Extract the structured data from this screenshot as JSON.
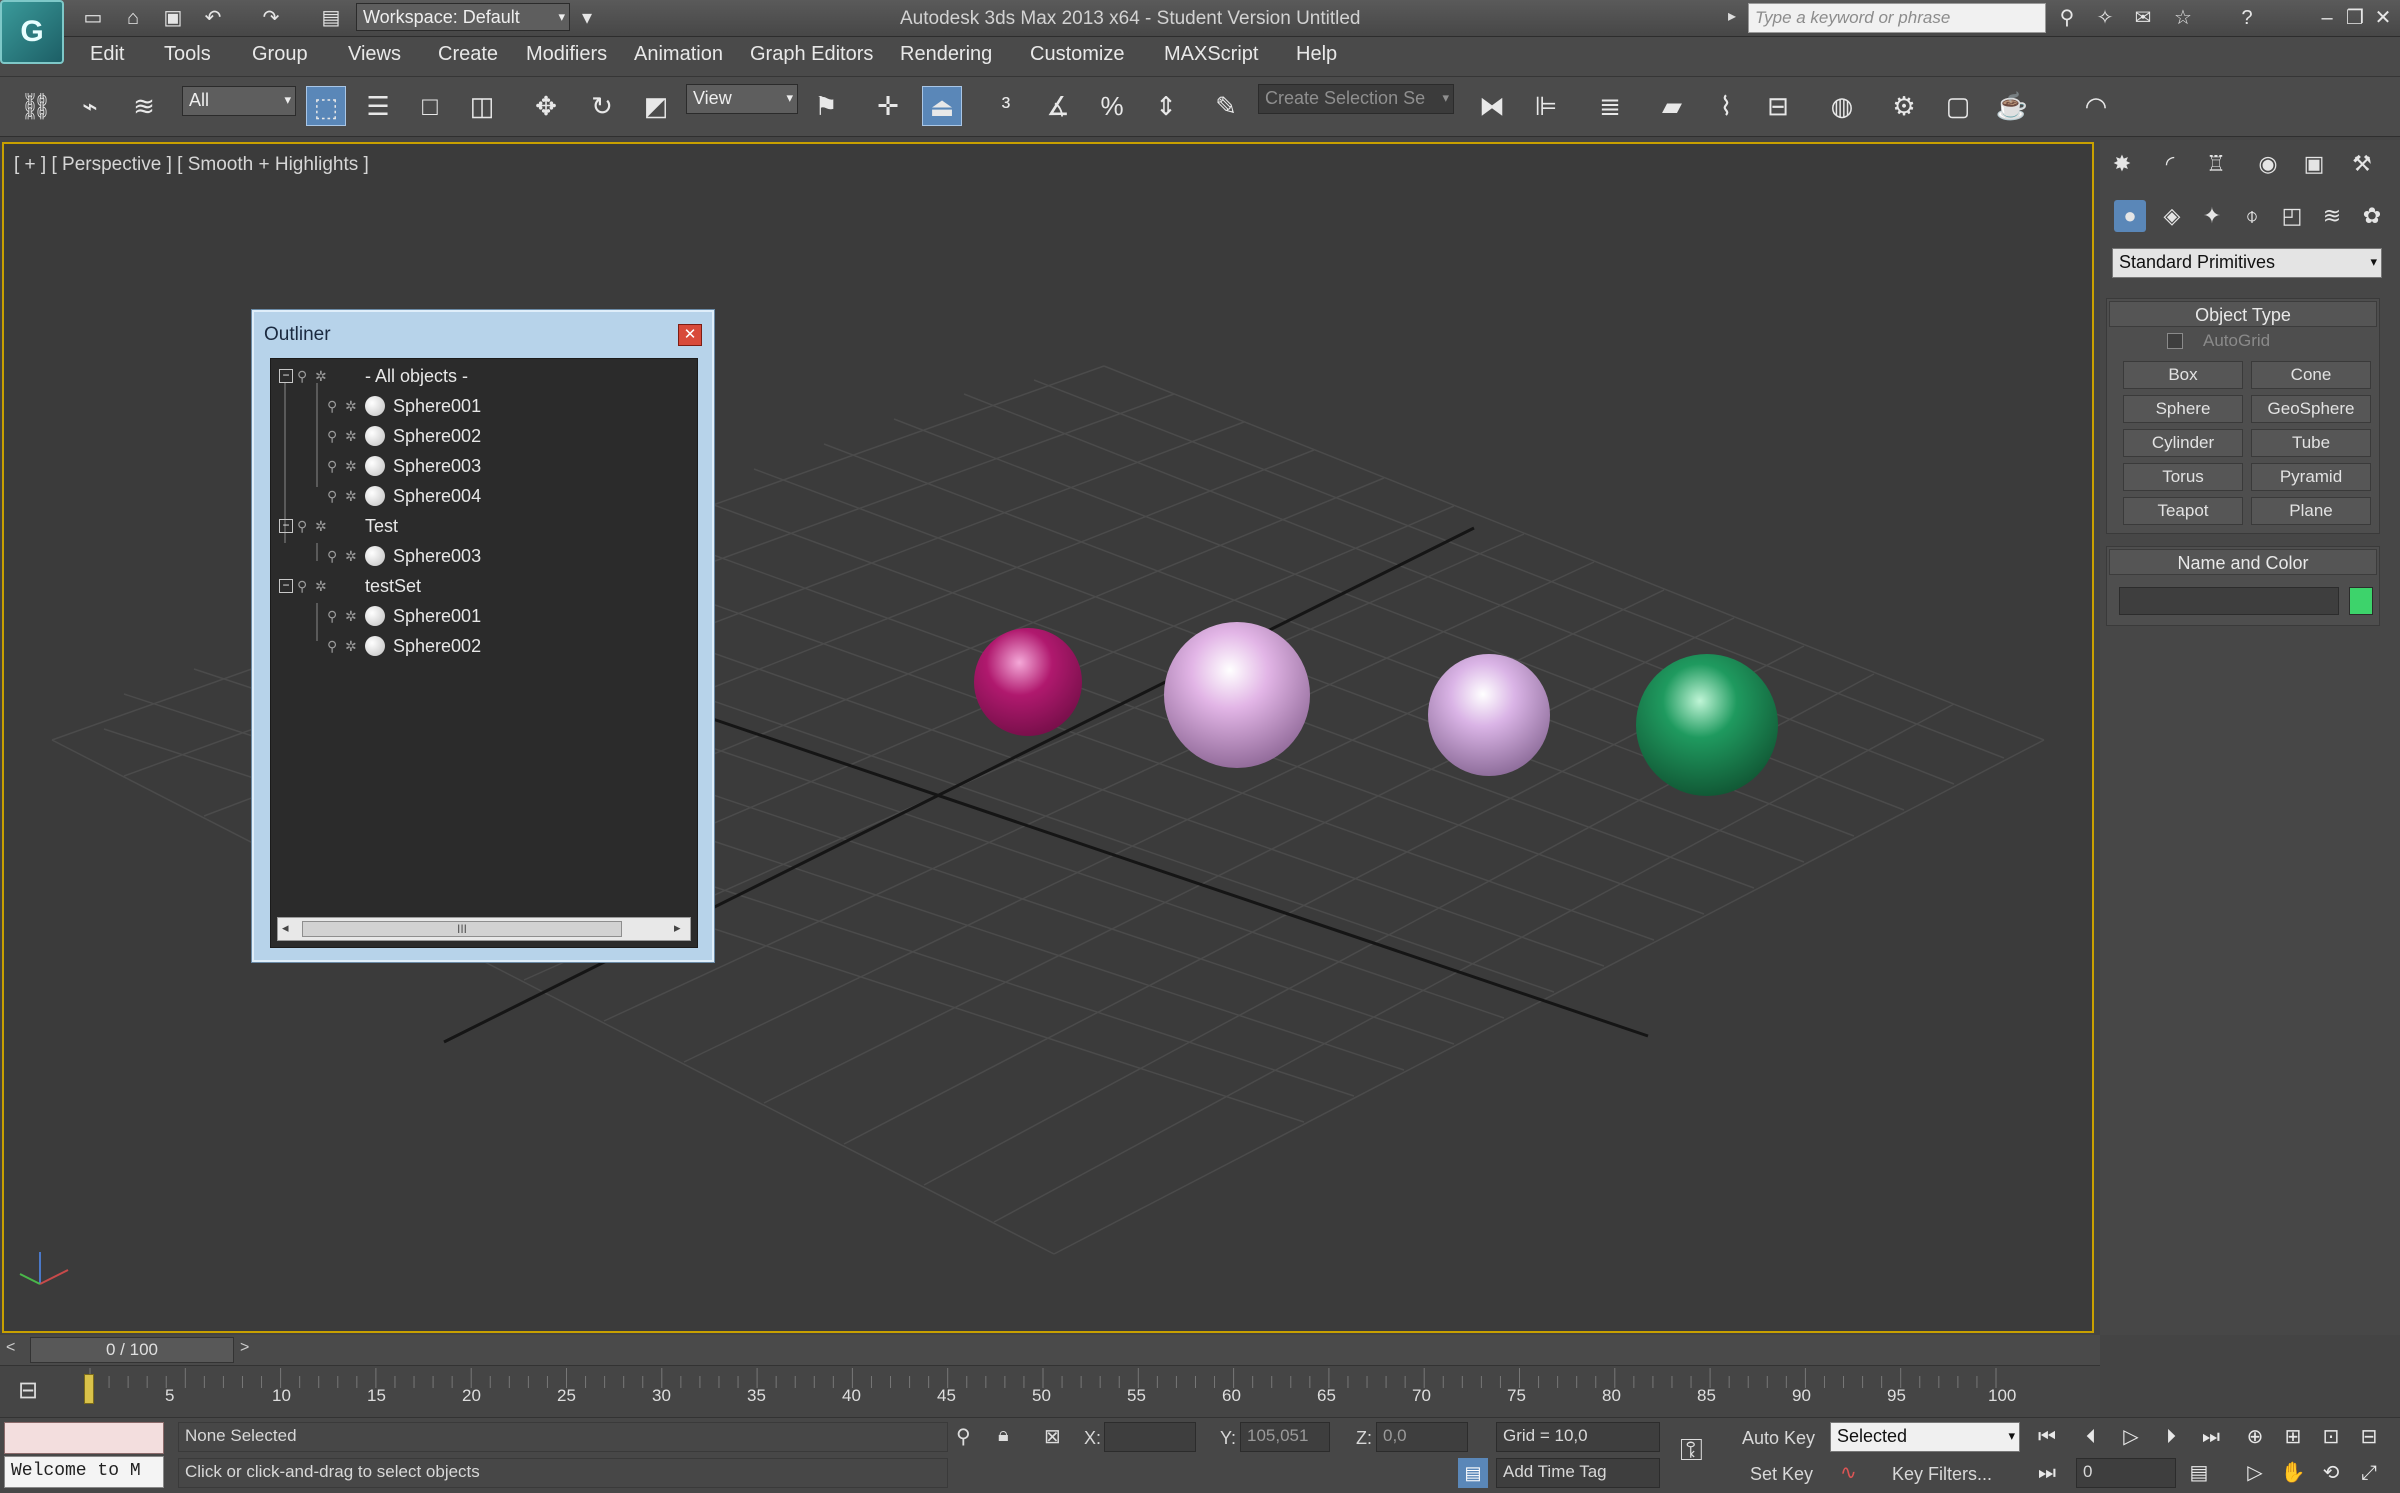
{
  "window": {
    "title": "Autodesk 3ds Max  2013 x64  - Student Version    Untitled",
    "workspace": "Workspace: Default",
    "search_placeholder": "Type a keyword or phrase"
  },
  "menu": [
    "Edit",
    "Tools",
    "Group",
    "Views",
    "Create",
    "Modifiers",
    "Animation",
    "Graph Editors",
    "Rendering",
    "Customize",
    "MAXScript",
    "Help"
  ],
  "toolbar": {
    "filter": "All",
    "ref_coord": "View",
    "selection_set_placeholder": "Create Selection Se"
  },
  "viewport": {
    "label": "[ + ] [ Perspective ] [ Smooth + Highlights ]",
    "sphere_colors": [
      "#b0196e",
      "#e2b5e6",
      "#dab4e6",
      "#1f9a5f"
    ]
  },
  "outliner": {
    "title": "Outliner",
    "close": "✕",
    "root": "- All objects -",
    "all_objects": [
      "Sphere001",
      "Sphere002",
      "Sphere003",
      "Sphere004"
    ],
    "groups": [
      {
        "name": "Test",
        "children": [
          "Sphere003"
        ]
      },
      {
        "name": "testSet",
        "children": [
          "Sphere001",
          "Sphere002"
        ]
      }
    ],
    "scroll_thumb": "III"
  },
  "command_panel": {
    "category": "Standard Primitives",
    "object_type_title": "Object Type",
    "autogrid": "AutoGrid",
    "buttons": [
      "Box",
      "Cone",
      "Sphere",
      "GeoSphere",
      "Cylinder",
      "Tube",
      "Torus",
      "Pyramid",
      "Teapot",
      "Plane"
    ],
    "name_color_title": "Name and Color",
    "object_color": "#3dd36b"
  },
  "timeline": {
    "frame_readout": "0 / 100",
    "ticks": [
      "5",
      "10",
      "15",
      "20",
      "25",
      "30",
      "35",
      "40",
      "45",
      "50",
      "55",
      "60",
      "65",
      "70",
      "75",
      "80",
      "85",
      "90",
      "95",
      "100"
    ]
  },
  "status": {
    "maxscript_listener": "Welcome to M",
    "selection": "None Selected",
    "prompt": "Click or click-and-drag to select objects",
    "x_label": "X:",
    "y_label": "Y:",
    "y_value": "105,051",
    "z_label": "Z:",
    "z_value": "0,0",
    "grid": "Grid = 10,0",
    "add_time_tag": "Add Time Tag",
    "auto_key": "Auto Key",
    "set_key": "Set Key",
    "key_mode": "Selected",
    "key_filters": "Key Filters...",
    "current_frame": "0"
  }
}
